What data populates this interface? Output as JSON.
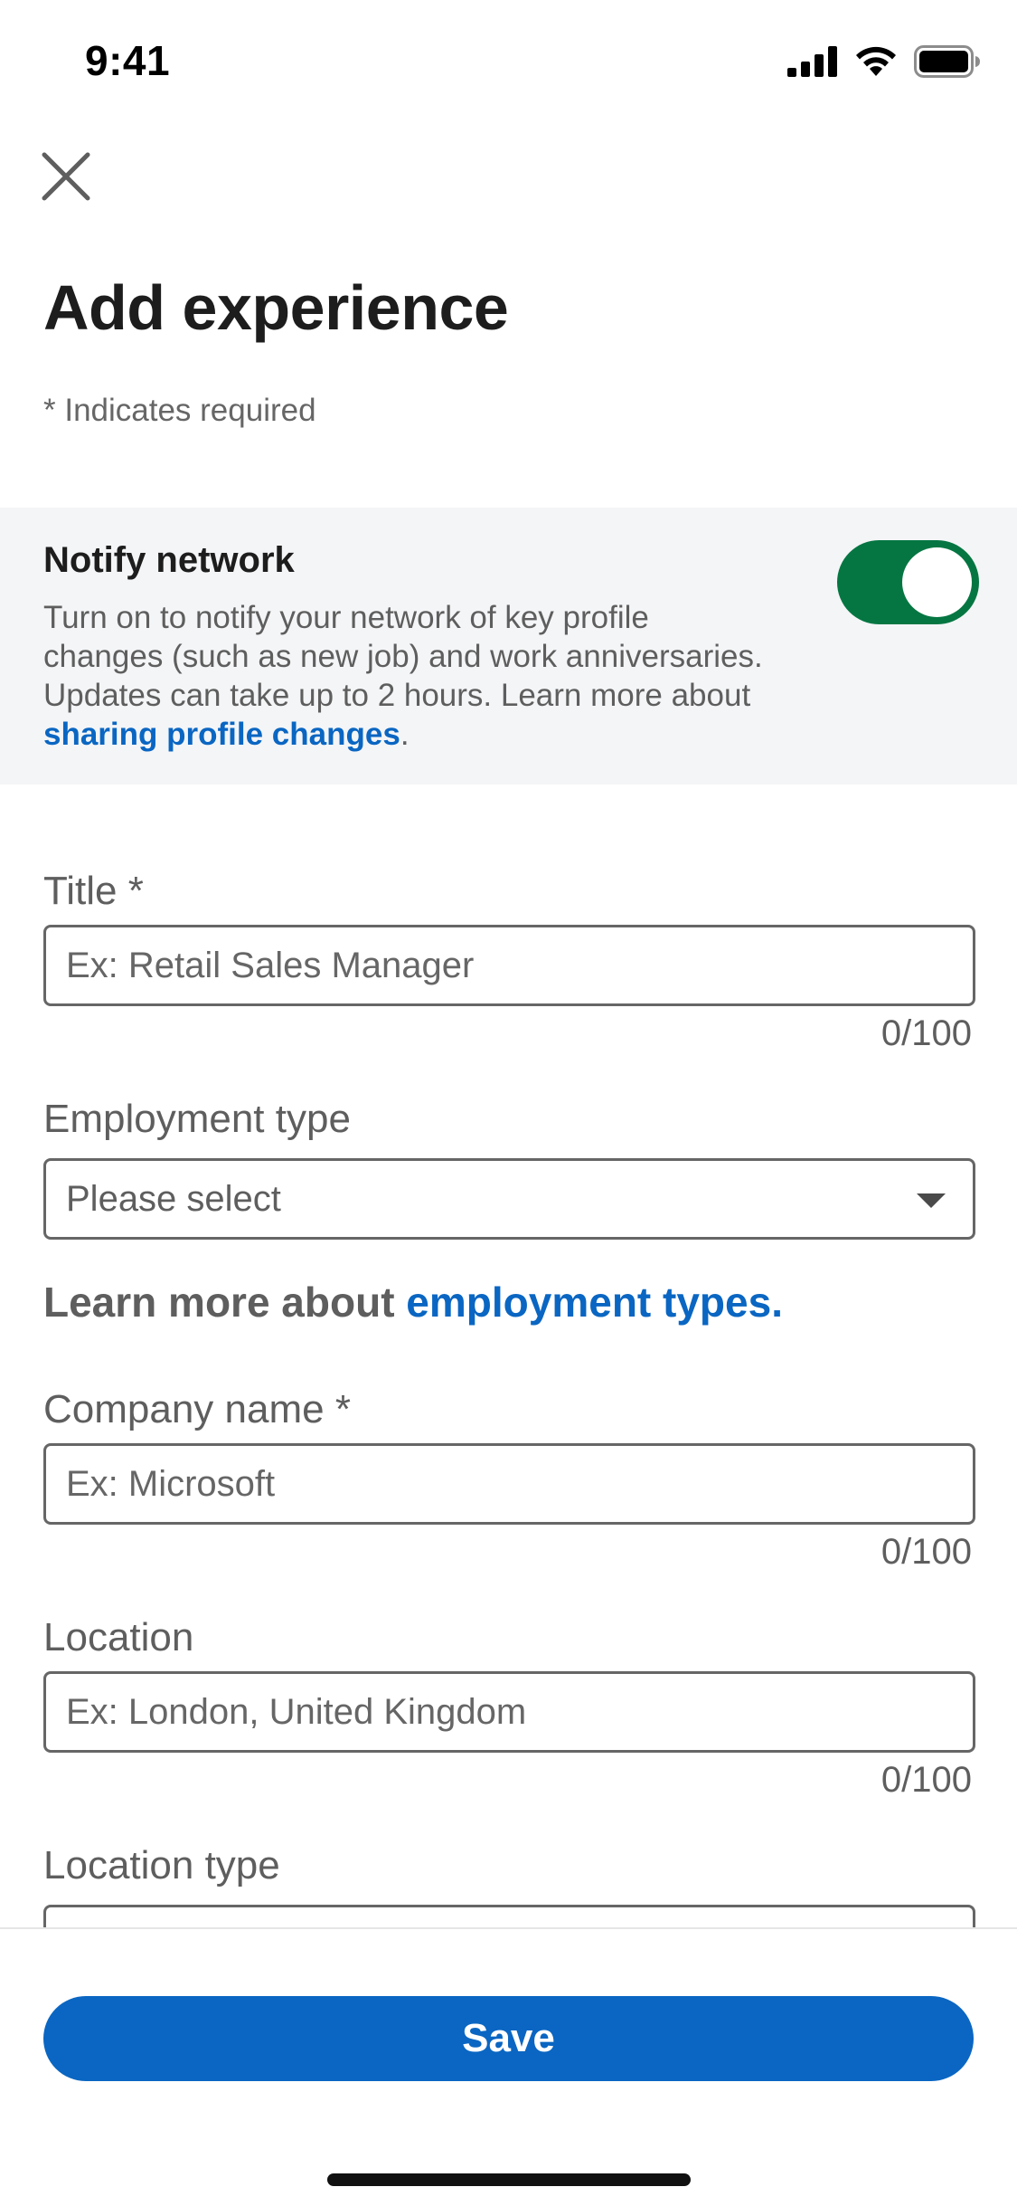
{
  "status_bar": {
    "time": "9:41",
    "icons": [
      "cellular-signal-icon",
      "wifi-icon",
      "battery-icon"
    ]
  },
  "header": {
    "close_icon": "close-icon",
    "title": "Add experience",
    "required_note": "* Indicates required"
  },
  "notify": {
    "title": "Notify network",
    "description": "Turn on to notify your network of key profile changes (such as new job) and work anniversaries. Updates can take up to 2 hours. Learn more about ",
    "link_text": "sharing profile changes",
    "suffix": ".",
    "toggle_on": true
  },
  "fields": {
    "title": {
      "label": "Title *",
      "placeholder": "Ex: Retail Sales Manager",
      "counter": "0/100"
    },
    "employment_type": {
      "label": "Employment type",
      "value": "Please select"
    },
    "employment_learn_more": {
      "prefix": "Learn more about ",
      "link_text": "employment types",
      "suffix": "."
    },
    "company": {
      "label": "Company name *",
      "placeholder": "Ex: Microsoft",
      "counter": "0/100"
    },
    "location": {
      "label": "Location",
      "placeholder": "Ex: London, United Kingdom",
      "counter": "0/100"
    },
    "location_type": {
      "label": "Location type"
    }
  },
  "footer": {
    "save_label": "Save"
  },
  "colors": {
    "brand_blue": "#0a66c2",
    "toggle_green": "#057642",
    "panel_bg": "#f4f5f7"
  }
}
